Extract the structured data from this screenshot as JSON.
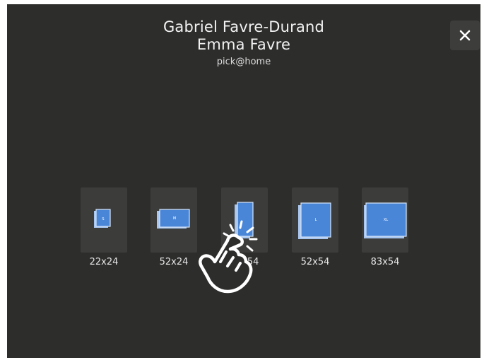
{
  "header": {
    "name_line1": "Gabriel Favre-Durand",
    "name_line2": "Emma Favre",
    "tagline": "pick@home"
  },
  "close_icon": "close-icon",
  "book_options": [
    {
      "size": "22x24",
      "badge": "S"
    },
    {
      "size": "52x24",
      "badge": "M"
    },
    {
      "size": "22x54",
      "badge": ""
    },
    {
      "size": "52x54",
      "badge": "L"
    },
    {
      "size": "83x54",
      "badge": "XL"
    }
  ],
  "overlay": {
    "icon": "tap-hand-icon"
  },
  "colors": {
    "background": "#2d2d2c",
    "tile": "#3c3c3b",
    "book_blue": "#4a86d8"
  }
}
